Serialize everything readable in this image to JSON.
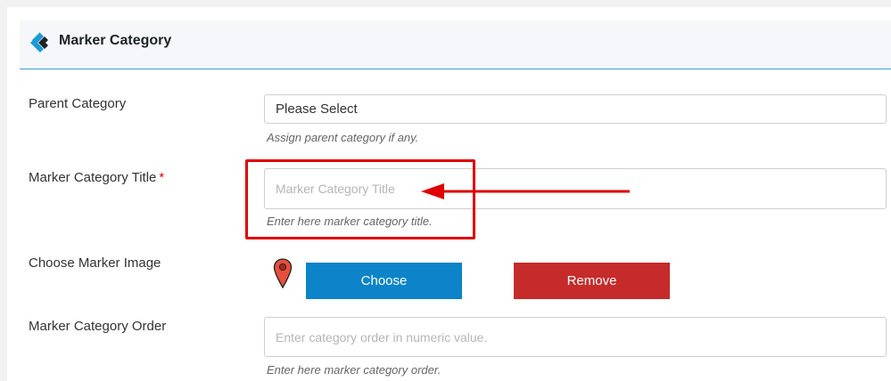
{
  "header": {
    "title": "Marker Category"
  },
  "form": {
    "parent_category": {
      "label": "Parent Category",
      "value": "Please Select",
      "help": "Assign parent category if any."
    },
    "title": {
      "label": "Marker Category Title",
      "required_mark": "*",
      "placeholder": "Marker Category Title",
      "help": "Enter here marker category title."
    },
    "image": {
      "label": "Choose Marker Image",
      "choose_label": "Choose",
      "remove_label": "Remove"
    },
    "order": {
      "label": "Marker Category Order",
      "placeholder": "Enter category order in numeric value.",
      "help": "Enter here marker category order."
    }
  },
  "colors": {
    "choose_button": "#0d84c9",
    "remove_button": "#c62b2b",
    "annotation": "#e00000",
    "header_border": "#3aa0d8"
  },
  "icons": {
    "logo": "plugin-logo-icon",
    "marker": "map-marker-icon",
    "annotation_arrow": "arrow-left-icon"
  }
}
